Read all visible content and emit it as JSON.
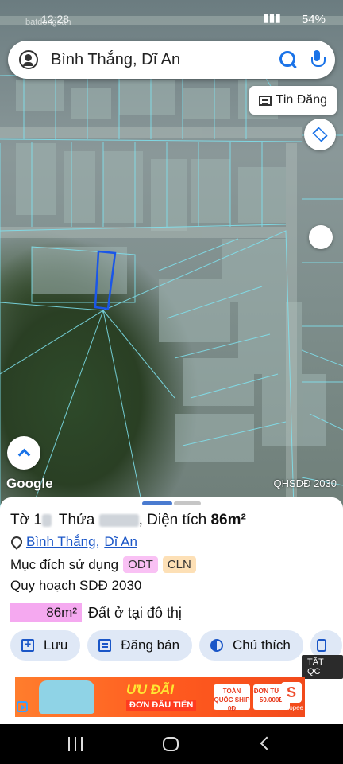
{
  "status_bar": {
    "time": "12:28",
    "watermark": "batdongsan",
    "battery": "54%"
  },
  "search": {
    "query": "Bình Thắng, Dĩ An"
  },
  "map": {
    "tin_dang_label": "Tin Đăng",
    "google_logo": "Google",
    "layer_code": "QHSDĐ 2030"
  },
  "parcel": {
    "sheet_prefix": "Tờ 1",
    "parcel_prefix": "Thửa",
    "area_prefix": ", Diện tích",
    "area_value": "86m²",
    "location_ward": "Bình Thắng",
    "location_district": "Dĩ An",
    "purpose_label": "Mục đích sử dụng",
    "purpose_tags": [
      "ODT",
      "CLN"
    ],
    "planning_label": "Quy hoạch SDĐ 2030",
    "planning_area": "86m²",
    "planning_desc": "Đất ở tại đô thị"
  },
  "actions": {
    "save": "Lưu",
    "post_sale": "Đăng bán",
    "legend": "Chú thích"
  },
  "ad": {
    "close_label": "TẮT QC",
    "headline": "ƯU ĐÃI",
    "subline": "ĐƠN ĐẦU TIÊN",
    "coupon1": "TOÀN QUỐC SHIP 0Đ",
    "coupon2": "ĐƠN TỪ 0Đ 50.000Đ",
    "brand": "Shopee"
  },
  "colors": {
    "accent": "#1a73e8",
    "chip_bg": "#dfe8f6",
    "odt_tag": "#f9c1f4",
    "cln_tag": "#fde0b6"
  }
}
